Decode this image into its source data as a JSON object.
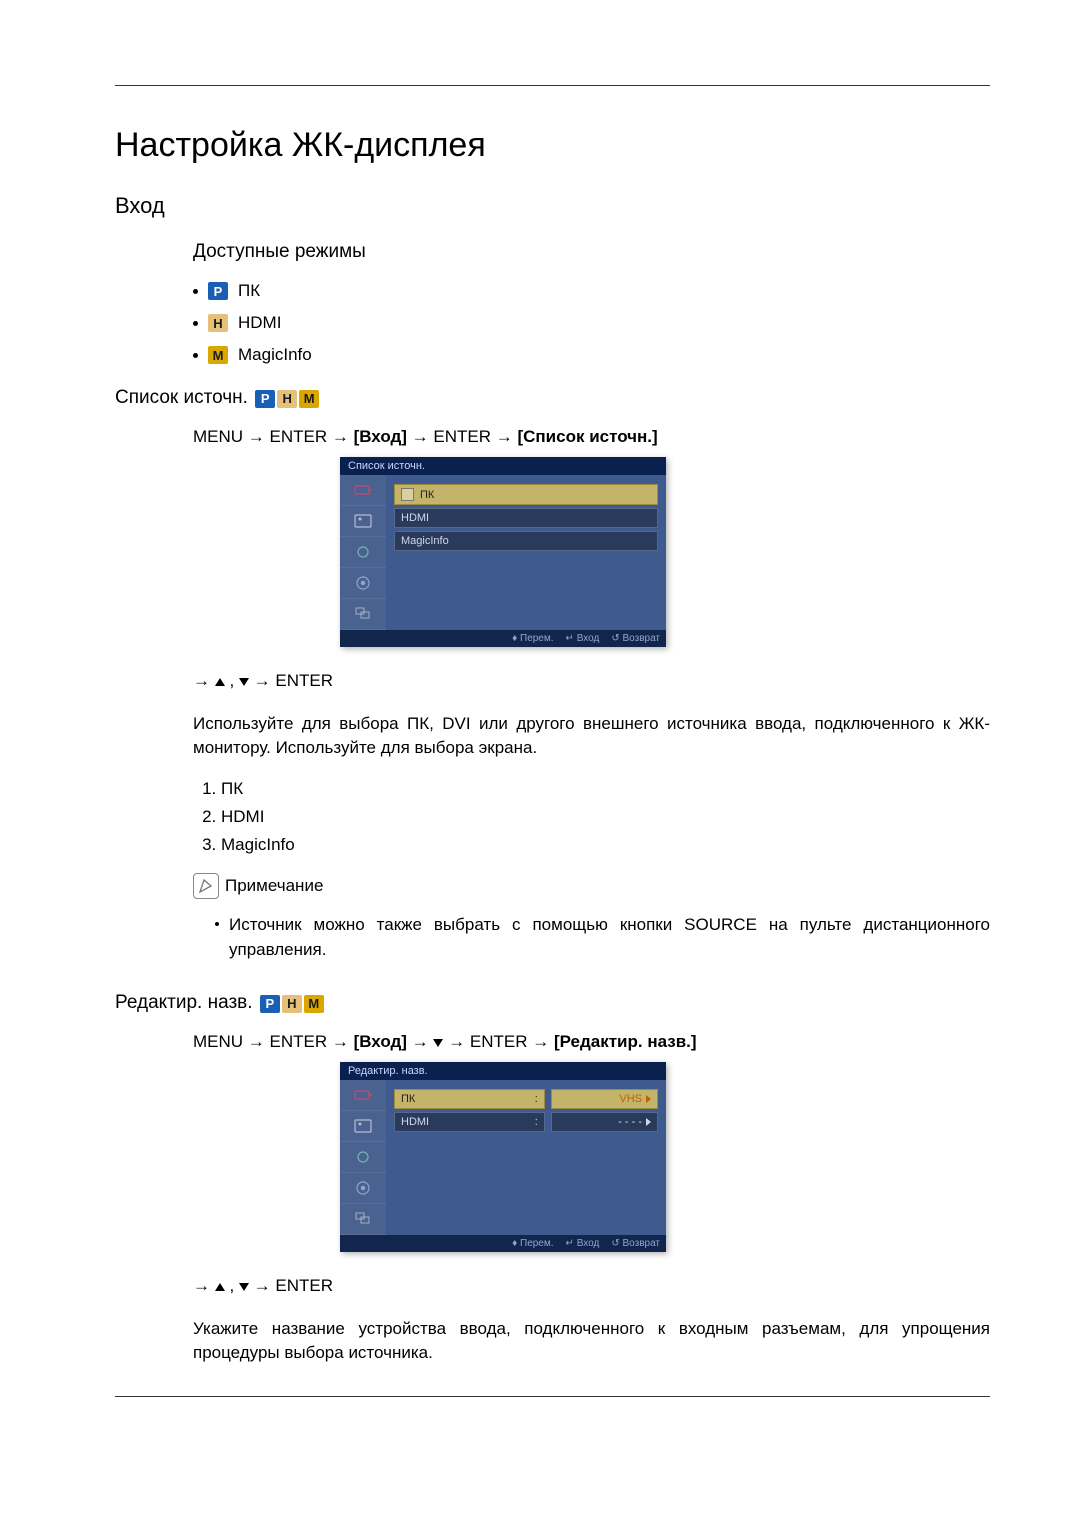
{
  "page": {
    "title": "Настройка ЖК-дисплея",
    "h_input": "Вход",
    "h_modes": "Доступные режимы",
    "modes": [
      {
        "badge": "P",
        "label": "ПК"
      },
      {
        "badge": "H",
        "label": "HDMI"
      },
      {
        "badge": "M",
        "label": "MagicInfo"
      }
    ]
  },
  "source_list": {
    "heading": "Список источн.",
    "path_menu": "MENU → ENTER →",
    "path_b1": "[Вход]",
    "path_mid": "→ ENTER →",
    "path_b2": "[Список источн.]",
    "osd_title": "Список источн.",
    "osd_items": [
      {
        "label": "ПК",
        "selected": true,
        "checked": true
      },
      {
        "label": "HDMI",
        "selected": false,
        "checked": false
      },
      {
        "label": "MagicInfo",
        "selected": false,
        "checked": false
      }
    ],
    "footer_move": "Перем.",
    "footer_enter": "Вход",
    "footer_return": "Возврат",
    "nav_hint_pre": "→",
    "nav_hint_mid": ",",
    "nav_hint_post": "→ ENTER",
    "desc": "Используйте для выбора ПК, DVI или другого внешнего источника ввода, подключенного к ЖК-монитору. Используйте для выбора экрана.",
    "ol": [
      "ПК",
      "HDMI",
      "MagicInfo"
    ],
    "note_label": "Примечание",
    "note_text": "Источник можно также выбрать с помощью кнопки SOURCE на пульте дистанционного управления."
  },
  "edit_name": {
    "heading": "Редактир. назв.",
    "path_menu": "MENU → ENTER →",
    "path_b1": "[Вход]",
    "path_mid1": "→",
    "path_mid2": "→ ENTER →",
    "path_b2": "[Редактир. назв.]",
    "osd_title": "Редактир. назв.",
    "rows": [
      {
        "left": "ПК",
        "right": "VHS",
        "selected": true
      },
      {
        "left": "HDMI",
        "right": "- - - -",
        "selected": false
      }
    ],
    "footer_move": "Перем.",
    "footer_enter": "Вход",
    "footer_return": "Возврат",
    "nav_hint_pre": "→",
    "nav_hint_mid": ",",
    "nav_hint_post": "→ ENTER",
    "desc": "Укажите название устройства ввода, подключенного к входным разъемам, для упрощения процедуры выбора источника."
  }
}
